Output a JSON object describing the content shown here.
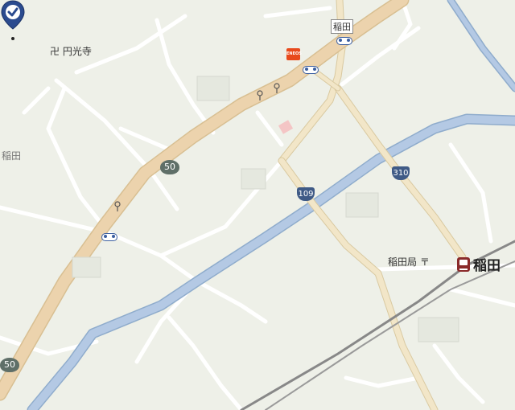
{
  "map": {
    "labels": {
      "temple": "円光寺",
      "area": "稲田",
      "post_office": "稲田局",
      "station": "稲田",
      "bus_stop_top": "稲田"
    },
    "icons": {
      "temple": "卍",
      "post": "〒",
      "gas_station": "ENEOS"
    },
    "route_shields": {
      "r50_top": "50",
      "r50_bottom": "50",
      "r109": "109",
      "r310": "310"
    },
    "colors": {
      "background": "#eef0e8",
      "minor_road": "#ffffff",
      "major_road": "#f2e6c8",
      "national_highway": "#ecd3ad",
      "river": "#b4c9e4",
      "railway": "#777777",
      "pin": "#2b4b8f"
    }
  }
}
